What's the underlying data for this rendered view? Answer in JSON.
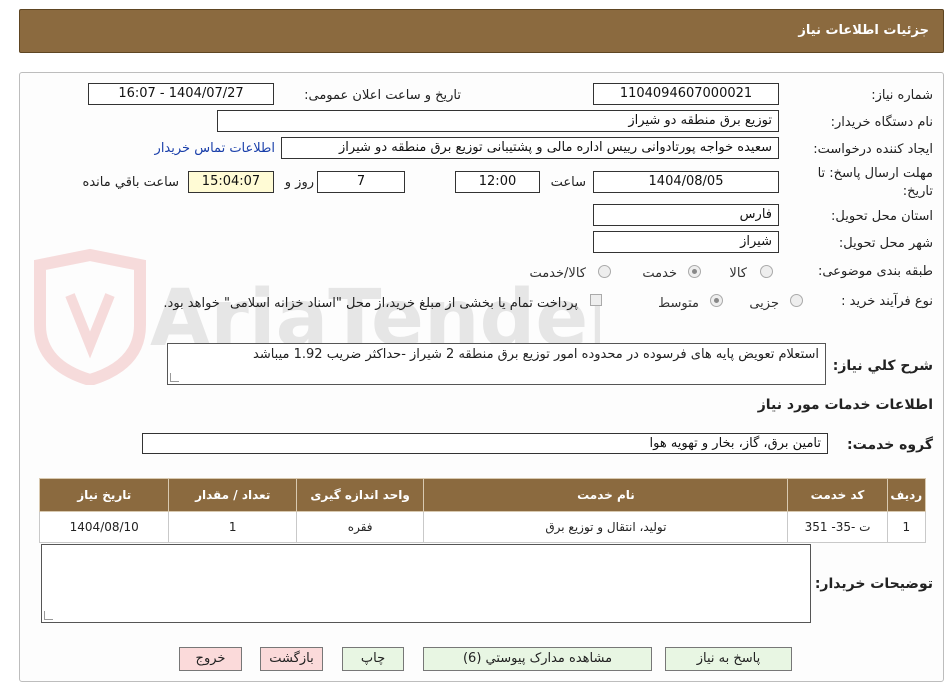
{
  "header": {
    "title": "جزئیات اطلاعات نیاز"
  },
  "form": {
    "need_number_label": "شماره نیاز:",
    "need_number": "1104094607000021",
    "announce_label": "تاریخ و ساعت اعلان عمومی:",
    "announce_value": "1404/07/27 - 16:07",
    "buyer_org_label": "نام دستگاه خریدار:",
    "buyer_org": "توزیع برق منطقه دو شیراز",
    "creator_label": "ایجاد کننده درخواست:",
    "creator": "سعیده خواجه پورتادوانی رییس اداره مالی و پشتیبانی  توزیع برق منطقه دو شیراز",
    "contact_link": "اطلاعات تماس خریدار",
    "deadline_label_1": "مهلت ارسال پاسخ: تا",
    "deadline_label_2": "تاریخ:",
    "deadline_date": "1404/08/05",
    "time_label": "ساعت",
    "deadline_time": "12:00",
    "days": "7",
    "days_label": "روز و",
    "remaining_time": "15:04:07",
    "remaining_label": "ساعت باقي مانده",
    "province_label": "استان محل تحویل:",
    "province": "فارس",
    "city_label": "شهر محل تحویل:",
    "city": "شیراز",
    "category_label": "طبقه بندی موضوعی:",
    "category_options": [
      "کالا",
      "خدمت",
      "کالا/خدمت"
    ],
    "category_selected": "خدمت",
    "process_label": "نوع فرآیند خرید :",
    "process_options": [
      "جزیی",
      "متوسط"
    ],
    "process_selected": "متوسط",
    "payment_note": "پرداخت تمام یا بخشی از مبلغ خرید،از محل \"اسناد خزانه اسلامی\" خواهد بود.",
    "description_label": "شرح کلي نياز:",
    "description": "استعلام تعویض پایه های فرسوده در محدوده امور توزیع برق منطقه 2 شیراز -حداکثر ضریب 1.92 میباشد"
  },
  "services": {
    "section_title": "اطلاعات خدمات مورد نیاز",
    "group_label": "گروه خدمت:",
    "group_value": "تامین برق، گاز، بخار و تهویه هوا",
    "columns": [
      "ردیف",
      "کد خدمت",
      "نام خدمت",
      "واحد اندازه گیری",
      "تعداد / مقدار",
      "تاریخ نیاز"
    ],
    "rows": [
      [
        "1",
        "ت -35- 351",
        "تولید، انتقال و توزیع برق",
        "فقره",
        "1",
        "1404/08/10"
      ]
    ]
  },
  "buyer_notes_label": "توضیحات خریدار:",
  "buttons": {
    "reply": "پاسخ به نیاز",
    "attachments": "مشاهده مدارک پیوستي (6)",
    "print": "چاپ",
    "back": "بازگشت",
    "exit": "خروج"
  },
  "watermark": "AriaTender.neT",
  "colors": {
    "header_bg": "#8b6a3f",
    "remaining_bg": "#fffbd5",
    "link": "#1a3faa"
  }
}
